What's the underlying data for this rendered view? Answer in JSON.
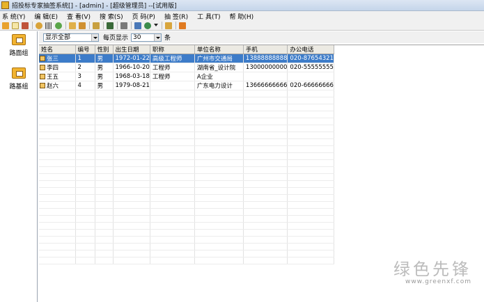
{
  "window": {
    "title": "招投标专家抽签系统[] - [admin] - [超级管理员] --[试用版]"
  },
  "menu": [
    "系 统(Y)",
    "编 辑(E)",
    "查 看(V)",
    "搜 索(S)",
    "页 码(P)",
    "抽 签(R)",
    "工 具(T)",
    "帮 助(H)"
  ],
  "toolbar": {
    "icons": [
      "open-folder-icon",
      "new-file-icon",
      "books-icon",
      "search-icon",
      "barcode-icon",
      "refresh-icon",
      "export-icon",
      "import-icon",
      "handshake-icon",
      "save-icon",
      "tools-icon",
      "print-icon",
      "globe-icon",
      "dropdown-icon",
      "key-icon",
      "exit-icon"
    ]
  },
  "sidebar": {
    "items": [
      {
        "label": "路面组"
      },
      {
        "label": "路基组"
      }
    ]
  },
  "filter": {
    "scope": "显示全部",
    "per_page_label": "每页显示",
    "per_page_value": "30",
    "unit": "条"
  },
  "table": {
    "columns": [
      "姓名",
      "编号",
      "性别",
      "出生日期",
      "职称",
      "单位名称",
      "手机",
      "办公电话"
    ],
    "rows": [
      [
        "张三",
        "1",
        "男",
        "1972-01-22",
        "高级工程师",
        "广州市交通局",
        "13888888888",
        "020-87654321"
      ],
      [
        "李四",
        "2",
        "男",
        "1966-10-20",
        "工程师",
        "湖南省_设计院",
        "13000000000",
        "020-55555555"
      ],
      [
        "王五",
        "3",
        "男",
        "1968-03-18",
        "工程师",
        "A企业",
        "",
        ""
      ],
      [
        "赵六",
        "4",
        "男",
        "1979-08-21",
        "",
        "广东电力设计",
        "13666666666",
        "020-66666666"
      ]
    ],
    "selected_row": 0
  },
  "watermark": {
    "main": "绿色先锋",
    "sub": "www.greenxf.com"
  },
  "colors": {
    "selection": "#3d7cc9",
    "folder": "#f2b431"
  }
}
